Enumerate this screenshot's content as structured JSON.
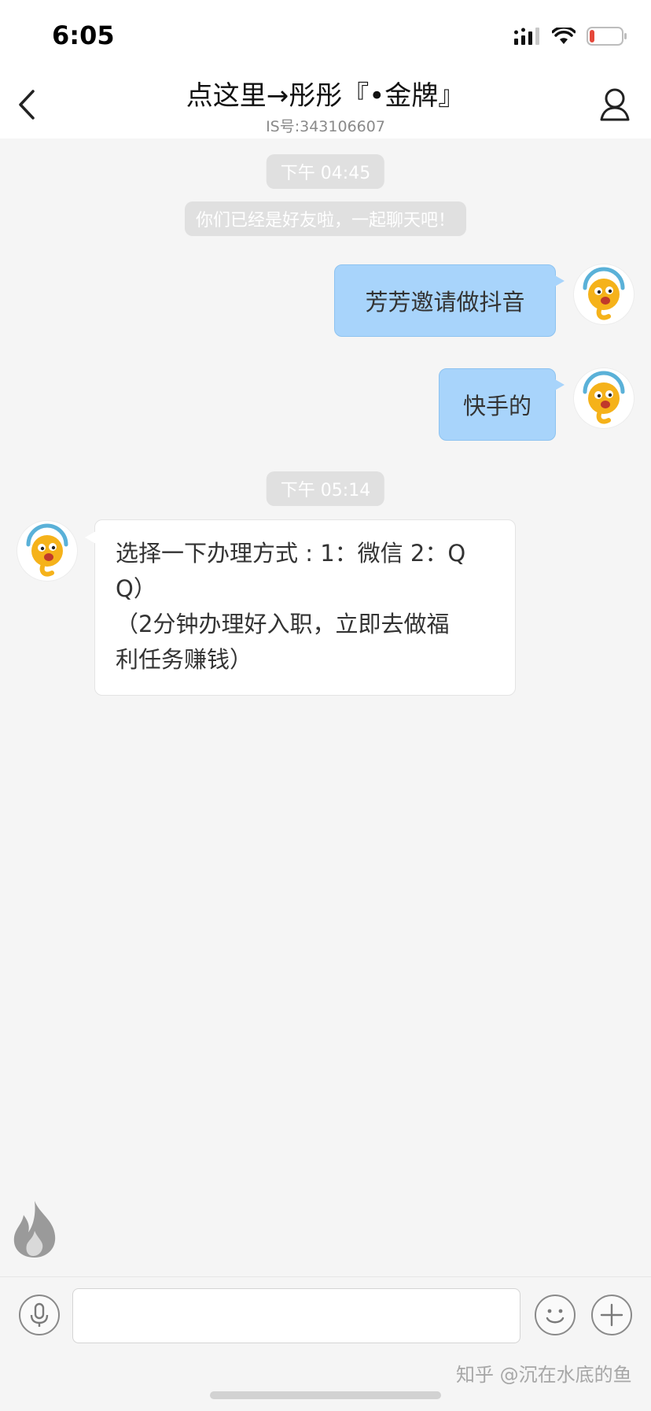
{
  "status_bar": {
    "time": "6:05",
    "icons": [
      "cellular-signal-icon",
      "wifi-icon",
      "battery-low-icon"
    ],
    "battery_color": "#e5473a"
  },
  "header": {
    "title": "点这里→彤彤『•金牌』",
    "subtitle": "IS号:343106607",
    "back_icon": "back-chevron-icon",
    "profile_icon": "profile-icon"
  },
  "chat": {
    "time_1": "下午 04:45",
    "system_note": "你们已经是好友啦，一起聊天吧！",
    "sent_1": "芳芳邀请做抖音",
    "sent_2": "快手的",
    "time_2": "下午 05:14",
    "received_1_line_1": "选择一下办理方式 : 1：微信 2：Q",
    "received_1_line_2": "Q）",
    "received_1_line_3": "（2分钟办理好入职，立即去做福",
    "received_1_line_4": "利任务赚钱）",
    "avatar_icon": "mascot-avatar-icon",
    "bubble_colors": {
      "outgoing": "#a8d4fb",
      "incoming": "#ffffff"
    }
  },
  "input_bar": {
    "voice_icon": "microphone-icon",
    "input_value": "",
    "emoji_icon": "smiley-icon",
    "add_icon": "plus-icon",
    "fire_icon": "fire-icon"
  },
  "watermark": "知乎 @沉在水底的鱼"
}
